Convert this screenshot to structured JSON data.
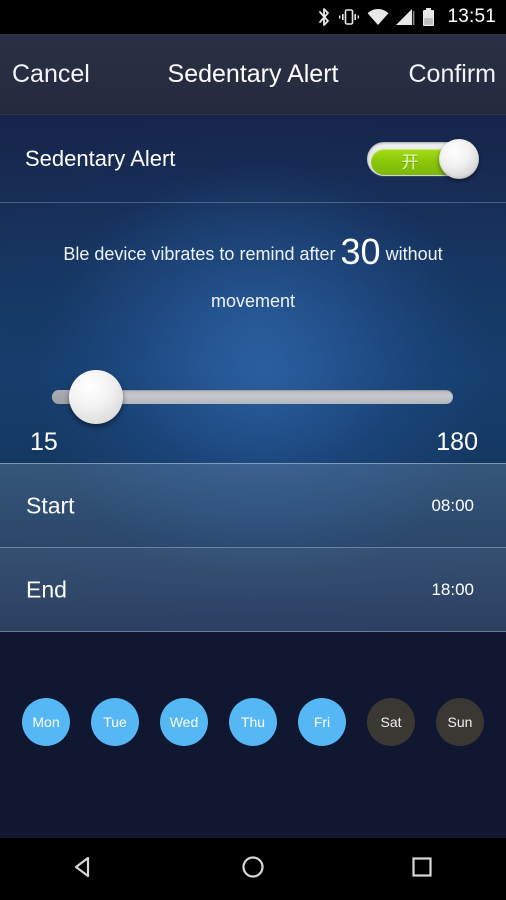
{
  "status_bar": {
    "time": "13:51",
    "icons": [
      "bluetooth-icon",
      "vibrate-icon",
      "wifi-icon",
      "signal-icon",
      "battery-icon"
    ]
  },
  "header": {
    "cancel_label": "Cancel",
    "title": "Sedentary Alert",
    "confirm_label": "Confirm"
  },
  "toggle_row": {
    "label": "Sedentary Alert",
    "switch_text": "开",
    "switch_state": "on",
    "accent_color": "#8ac60a"
  },
  "description": {
    "prefix": "Ble device vibrates to remind after",
    "value": "30",
    "suffix": "without movement"
  },
  "slider": {
    "min_label": "15",
    "max_label": "180",
    "min": 15,
    "max": 180,
    "value": 30
  },
  "time_rows": [
    {
      "label": "Start",
      "value": "08:00"
    },
    {
      "label": "End",
      "value": "18:00"
    }
  ],
  "days": [
    {
      "label": "Mon",
      "selected": true
    },
    {
      "label": "Tue",
      "selected": true
    },
    {
      "label": "Wed",
      "selected": true
    },
    {
      "label": "Thu",
      "selected": true
    },
    {
      "label": "Fri",
      "selected": true
    },
    {
      "label": "Sat",
      "selected": false
    },
    {
      "label": "Sun",
      "selected": false
    }
  ],
  "day_colors": {
    "selected": "#55b8f5",
    "unselected": "#3b3733"
  },
  "nav_bar": {
    "back": "back-triangle-icon",
    "home": "home-circle-icon",
    "recents": "recents-square-icon"
  }
}
